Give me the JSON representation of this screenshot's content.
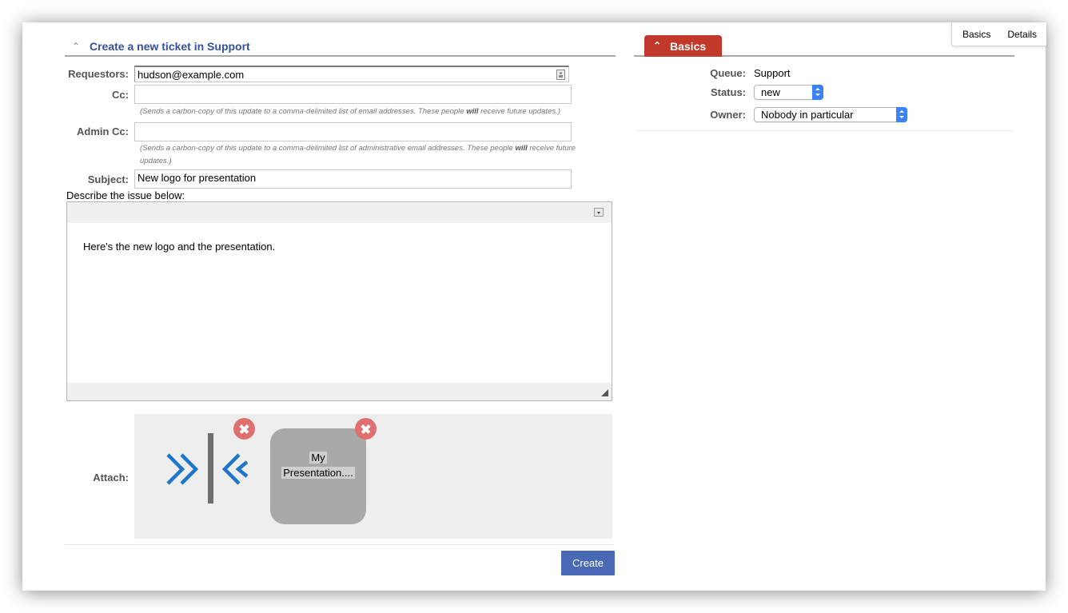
{
  "page_tabs": [
    {
      "label": "Basics"
    },
    {
      "label": "Details"
    }
  ],
  "ticket_form": {
    "title": "Create a new ticket in Support",
    "collapse_icon": "chevron-up-icon",
    "fields": {
      "requestors": {
        "label": "Requestors:",
        "value": "hudson@example.com",
        "icon": "address-book-icon"
      },
      "cc": {
        "label": "Cc:",
        "value": "",
        "hint_before": "(Sends a carbon-copy of this update to a comma-delimited list of email addresses. These people ",
        "hint_bold": "will",
        "hint_after": " receive future updates.)"
      },
      "admin_cc": {
        "label": "Admin Cc:",
        "value": "",
        "hint_before": "(Sends a carbon-copy of this update to a comma-delimited list of administrative email addresses. These people ",
        "hint_bold": "will",
        "hint_after": " receive future updates.)"
      },
      "subject": {
        "label": "Subject:",
        "value": "New logo for presentation"
      }
    },
    "describe_label": "Describe the issue below:",
    "editor": {
      "content": "Here's the new logo and the presentation.",
      "toolbar_icon": "dropdown-arrow-icon",
      "resize_icon": "resize-handle-icon"
    },
    "attach": {
      "label": "Attach:",
      "files": [
        {
          "name": "logo",
          "type": "image",
          "icon": "logo-thumbnail"
        },
        {
          "name_line1": "My",
          "name_line2": "Presentation....",
          "type": "document"
        }
      ],
      "remove_icon": "remove-circle-icon"
    },
    "create_button": "Create"
  },
  "basics_panel": {
    "title": "Basics",
    "collapse_icon": "chevron-up-icon",
    "queue": {
      "label": "Queue:",
      "value": "Support"
    },
    "status": {
      "label": "Status:",
      "value": "new"
    },
    "owner": {
      "label": "Owner:",
      "value": "Nobody in particular"
    }
  },
  "colors": {
    "title_blue": "#34519b",
    "basics_red": "#c0392b",
    "create_button": "#4a69b4",
    "remove_red": "#e07070",
    "select_blue": "#3b82f6",
    "logo_blue": "#1f76c8"
  }
}
